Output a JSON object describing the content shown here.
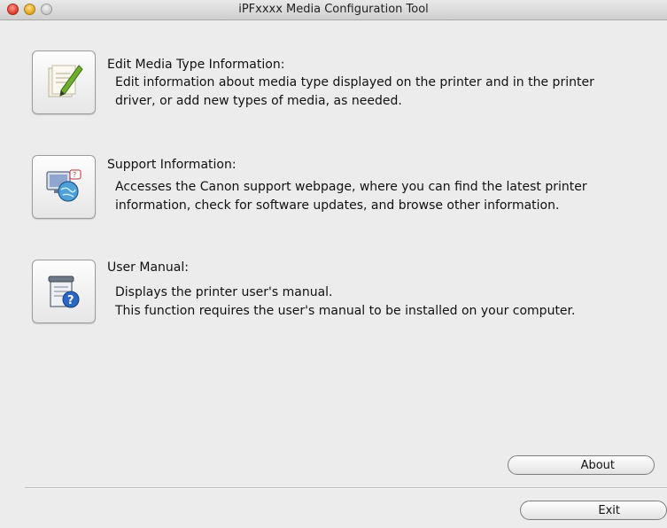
{
  "window": {
    "title": "iPFxxxx Media Configuration Tool"
  },
  "sections": {
    "edit_media": {
      "heading": "Edit Media Type Information:",
      "line1": "Edit information about media type displayed on the printer and in the printer",
      "line2": "driver, or add new types of media, as needed.",
      "icon": "edit-document-icon"
    },
    "support": {
      "heading": "Support Information:",
      "line1": "Accesses the Canon support webpage, where you can find the latest printer",
      "line2": "information, check for software updates, and browse other information.",
      "icon": "support-globe-icon"
    },
    "manual": {
      "heading": "User Manual:",
      "line1": "Displays the printer user's manual.",
      "line2": "This function requires the user's manual to be installed on your computer.",
      "icon": "user-manual-icon"
    }
  },
  "buttons": {
    "about": "About",
    "exit": "Exit"
  }
}
